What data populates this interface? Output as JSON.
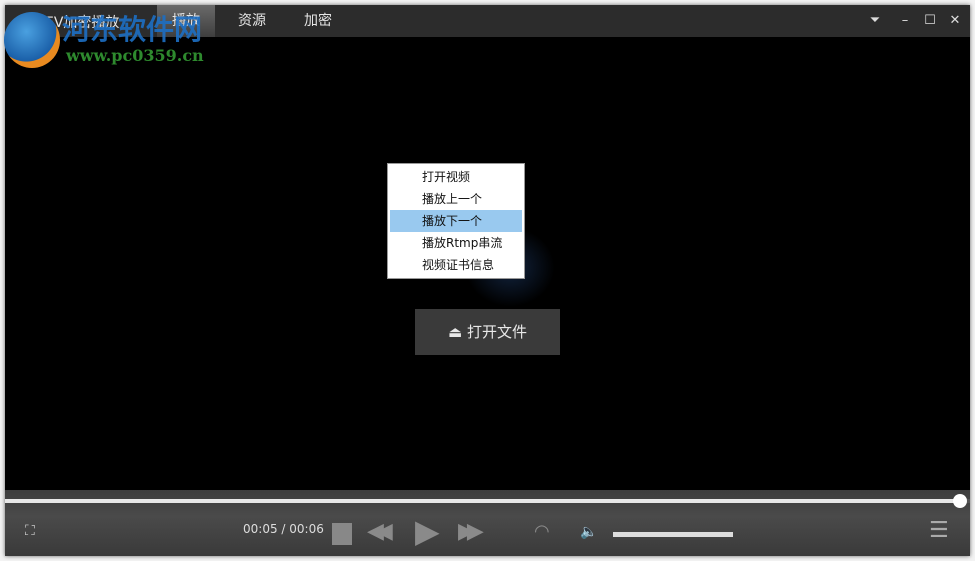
{
  "window": {
    "title": "EV加密播放",
    "tabs": [
      {
        "label": "播放",
        "active": true
      },
      {
        "label": "资源"
      },
      {
        "label": "加密"
      }
    ]
  },
  "context_menu": {
    "items": [
      "打开视频",
      "播放上一个",
      "播放下一个",
      "播放Rtmp串流",
      "视频证书信息"
    ],
    "highlighted_index": 2
  },
  "open_file": {
    "label": "打开文件"
  },
  "player": {
    "current_time": "00:05",
    "total_time": "00:06",
    "time_separator": " / ",
    "progress_percent": 99,
    "volume_percent": 100
  },
  "watermark": {
    "title": "河东软件网",
    "url": "www.pc0359.cn"
  },
  "colors": {
    "highlight": "#99c9ef",
    "titlebar": "#2c2c2c"
  }
}
